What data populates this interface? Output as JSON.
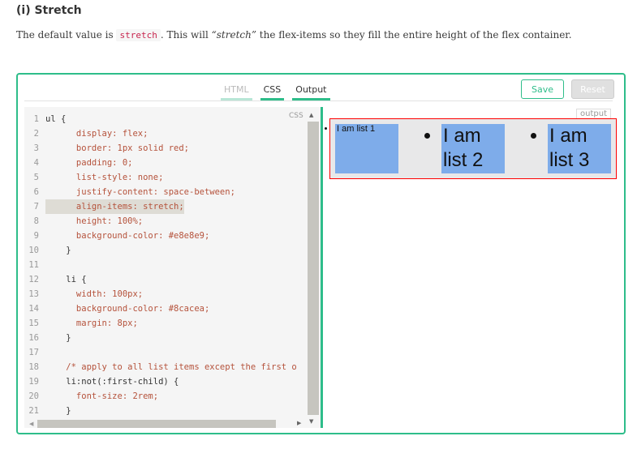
{
  "heading": "(i) Stretch",
  "description": {
    "pre": "The default value is ",
    "code": "stretch",
    "mid": ". This will ",
    "em": "“stretch”",
    "post": " the flex-items so they fill the entire height of the flex container."
  },
  "tabs": {
    "html": "HTML",
    "css": "CSS",
    "output": "Output"
  },
  "buttons": {
    "save": "Save",
    "reset": "Reset"
  },
  "code_badge": "CSS",
  "output_badge": "output",
  "code_lines": [
    {
      "n": "1",
      "t": "ul {"
    },
    {
      "n": "2",
      "t": "      display: flex;"
    },
    {
      "n": "3",
      "t": "      border: 1px solid red;"
    },
    {
      "n": "4",
      "t": "      padding: 0;"
    },
    {
      "n": "5",
      "t": "      list-style: none;"
    },
    {
      "n": "6",
      "t": "      justify-content: space-between;"
    },
    {
      "n": "7",
      "t": "      align-items: stretch;"
    },
    {
      "n": "8",
      "t": "      height: 100%;"
    },
    {
      "n": "9",
      "t": "      background-color: #e8e8e9;"
    },
    {
      "n": "10",
      "t": "    }"
    },
    {
      "n": "11",
      "t": ""
    },
    {
      "n": "12",
      "t": "    li {"
    },
    {
      "n": "13",
      "t": "      width: 100px;"
    },
    {
      "n": "14",
      "t": "      background-color: #8cacea;"
    },
    {
      "n": "15",
      "t": "      margin: 8px;"
    },
    {
      "n": "16",
      "t": "    }"
    },
    {
      "n": "17",
      "t": ""
    },
    {
      "n": "18",
      "t": "    /* apply to all list items except the first o"
    },
    {
      "n": "19",
      "t": "    li:not(:first-child) {"
    },
    {
      "n": "20",
      "t": "      font-size: 2rem;"
    },
    {
      "n": "21",
      "t": "    }"
    }
  ],
  "output_items": [
    "I am list 1",
    "I am list 2",
    "I am list 3"
  ],
  "colors": {
    "accent": "#2ebd8a",
    "flex_bg": "#e8e8e9",
    "item_bg": "#8cacea",
    "border": "red"
  }
}
